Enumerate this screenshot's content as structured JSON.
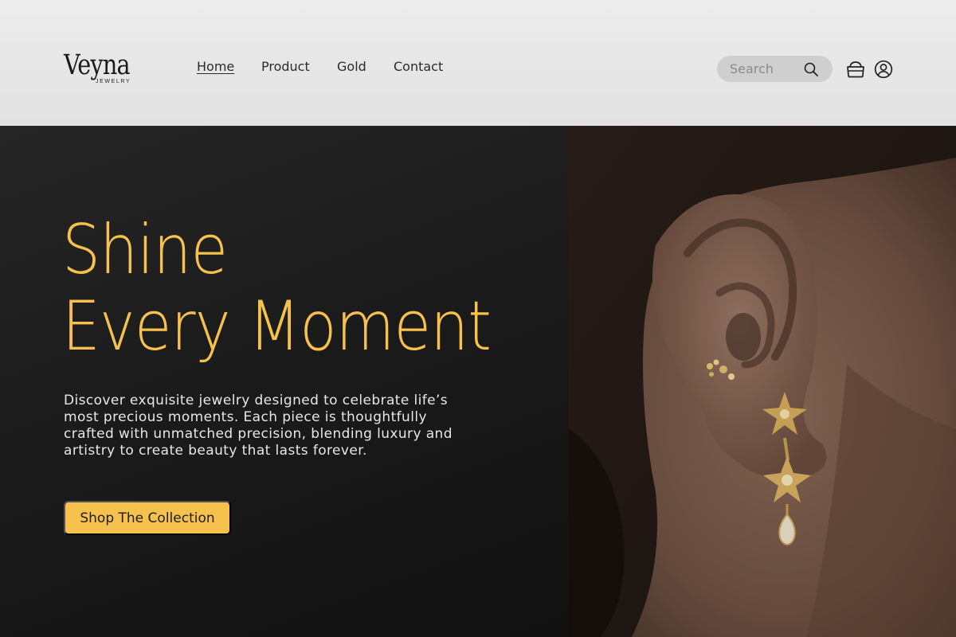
{
  "brand": {
    "name": "Veyna",
    "tagline": "JEWELRY"
  },
  "nav": {
    "items": [
      {
        "label": "Home",
        "active": true
      },
      {
        "label": "Product",
        "active": false
      },
      {
        "label": "Gold",
        "active": false
      },
      {
        "label": "Contact",
        "active": false
      }
    ]
  },
  "search": {
    "placeholder": "Search",
    "icon": "search-icon"
  },
  "header_icons": {
    "cart": "cart-icon",
    "account": "user-icon"
  },
  "hero": {
    "headline_line1": "Shine",
    "headline_line2": "Every Moment",
    "description": "Discover exquisite jewelry designed to celebrate life’s most precious moments. Each piece is thoughtfully crafted with unmatched precision, blending luxury and artistry to create beauty that lasts forever.",
    "cta_label": "Shop The Collection"
  },
  "colors": {
    "accent": "#f6c14d",
    "header_bg": "#e6e6e6",
    "hero_bg": "#1c1c1c",
    "search_bg": "#cfcfcf"
  }
}
